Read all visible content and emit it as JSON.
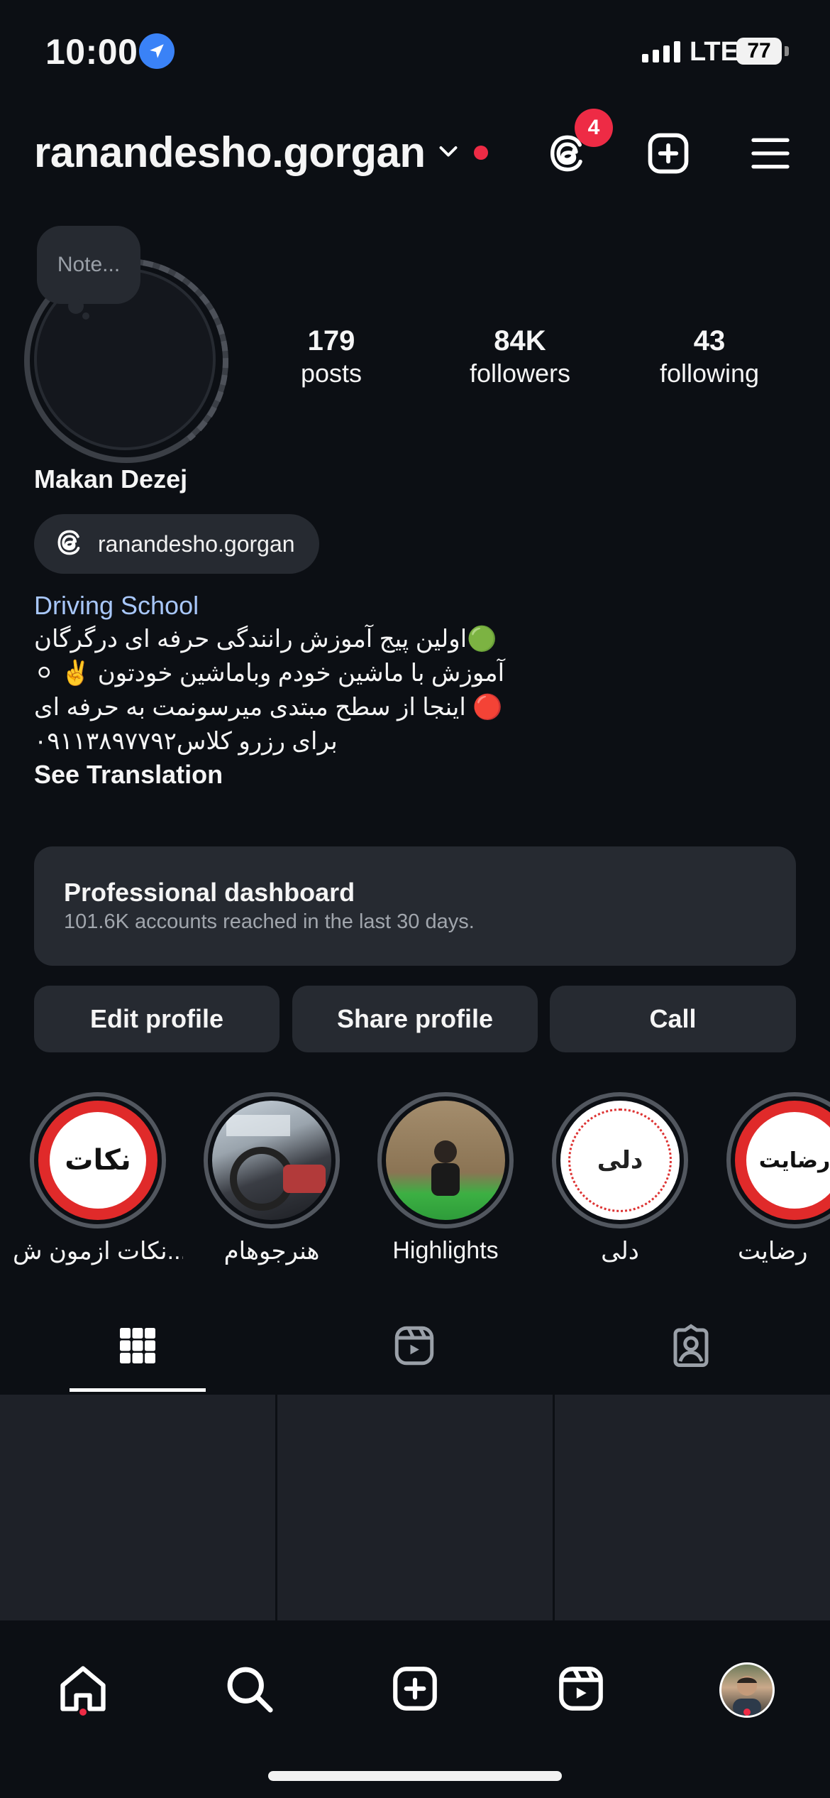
{
  "status_bar": {
    "time": "10:00",
    "network": "LTE",
    "battery": "77"
  },
  "header": {
    "username": "ranandesho.gorgan",
    "threads_badge": "4"
  },
  "note": {
    "placeholder": "Note..."
  },
  "stats": [
    {
      "value": "179",
      "label": "posts"
    },
    {
      "value": "84K",
      "label": "followers"
    },
    {
      "value": "43",
      "label": "following"
    }
  ],
  "profile": {
    "display_name": "Makan Dezej",
    "threads_handle": "ranandesho.gorgan",
    "category": "Driving School",
    "bio_lines": [
      "🟢اولین پیج آموزش رانندگی حرفه ای درگرگان",
      "آموزش با ماشین خودم وباماشین خودتون ✌️ ⚪",
      "🔴 اینجا از سطح مبتدی میرسونمت به حرفه ای",
      "برای رزرو کلاس۰۹۱۱۳۸۹۷۷۹۲"
    ],
    "see_translation": "See Translation"
  },
  "dashboard": {
    "title": "Professional dashboard",
    "subtitle": "101.6K accounts reached in the last 30 days."
  },
  "actions": {
    "edit": "Edit profile",
    "share": "Share profile",
    "call": "Call"
  },
  "highlights": [
    {
      "label": "نکات ازمون ش...",
      "cover_text": "نکات"
    },
    {
      "label": "هنرجوهام",
      "cover_text": ""
    },
    {
      "label": "Highlights",
      "cover_text": ""
    },
    {
      "label": "دلی",
      "cover_text": "دلی"
    },
    {
      "label": "رضایت",
      "cover_text": "رضایت"
    }
  ],
  "colors": {
    "accent_red": "#ee2b45",
    "link_blue": "#a8c7fa",
    "surface": "#262a31",
    "background": "#0c0f14"
  },
  "icons": [
    "location-arrow-icon",
    "threads-icon",
    "plus-square-icon",
    "menu-icon",
    "grid-icon",
    "reels-icon",
    "tagged-icon",
    "home-icon",
    "search-icon",
    "create-icon",
    "reels-nav-icon",
    "profile-avatar"
  ]
}
